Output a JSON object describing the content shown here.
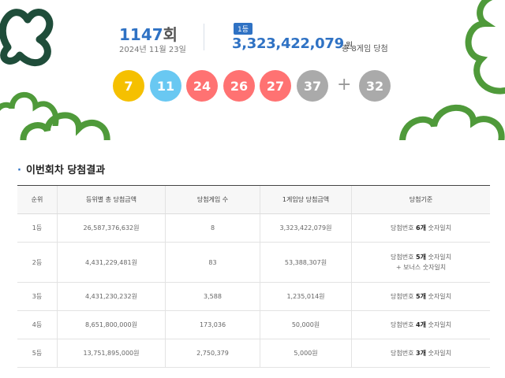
{
  "draw": {
    "round_number": "1147",
    "round_suffix": "회",
    "date": "2024년 11월 23일",
    "rank_badge": "1등",
    "first_prize_amount": "3,323,422,079",
    "first_prize_unit": "원",
    "winners_text": "총 8게임 당첨"
  },
  "numbers": [
    {
      "value": "7",
      "color": "#f5c000"
    },
    {
      "value": "11",
      "color": "#69c8f2"
    },
    {
      "value": "24",
      "color": "#ff7272"
    },
    {
      "value": "26",
      "color": "#ff7272"
    },
    {
      "value": "27",
      "color": "#ff7272"
    },
    {
      "value": "37",
      "color": "#aaaaaa"
    }
  ],
  "bonus": {
    "plus": "+",
    "value": "32",
    "color": "#aaaaaa"
  },
  "section": {
    "bullet": "·",
    "title": "이번회차 당첨결과"
  },
  "table": {
    "headers": [
      "순위",
      "등위별 총 당첨금액",
      "당첨게임 수",
      "1게임당 당첨금액",
      "당첨기준"
    ],
    "rows": [
      {
        "rank": "1등",
        "total": "26,587,376,632원",
        "games": "8",
        "per_game": "3,323,422,079원",
        "criteria_pre": "당첨번호 ",
        "criteria_bold": "6개",
        "criteria_post": " 숫자일치",
        "extra": ""
      },
      {
        "rank": "2등",
        "total": "4,431,229,481원",
        "games": "83",
        "per_game": "53,388,307원",
        "criteria_pre": "당첨번호 ",
        "criteria_bold": "5개",
        "criteria_post": " 숫자일치",
        "extra": "+ 보너스 숫자일치"
      },
      {
        "rank": "3등",
        "total": "4,431,230,232원",
        "games": "3,588",
        "per_game": "1,235,014원",
        "criteria_pre": "당첨번호 ",
        "criteria_bold": "5개",
        "criteria_post": " 숫자일치",
        "extra": ""
      },
      {
        "rank": "4등",
        "total": "8,651,800,000원",
        "games": "173,036",
        "per_game": "50,000원",
        "criteria_pre": "당첨번호 ",
        "criteria_bold": "4개",
        "criteria_post": " 숫자일치",
        "extra": ""
      },
      {
        "rank": "5등",
        "total": "13,751,895,000원",
        "games": "2,750,379",
        "per_game": "5,000원",
        "criteria_pre": "당첨번호 ",
        "criteria_bold": "3개",
        "criteria_post": " 숫자일치",
        "extra": ""
      }
    ]
  },
  "colors": {
    "accent": "#2f72c4",
    "leaf_dark": "#1f4d3a",
    "leaf_green": "#4f9a3a"
  }
}
